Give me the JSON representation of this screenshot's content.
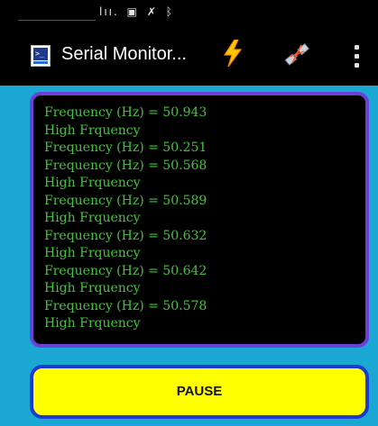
{
  "status_bar": {
    "signal_icon": "signal-bars-icon",
    "gallery_icon": "gallery-icon",
    "notification_icon": "muted-icon",
    "bluetooth_icon": "bluetooth-icon"
  },
  "app_bar": {
    "title": "Serial Monitor...",
    "app_icon": "serial-monitor-app-icon",
    "actions": [
      "lightning-bolt-icon",
      "connect-plug-icon",
      "overflow-menu-icon"
    ]
  },
  "monitor": {
    "lines": [
      "Frequency (Hz) = 50.943",
      "High Frquency",
      "Frequency (Hz) = 50.251",
      "Frequency (Hz) = 50.568",
      "High Frquency",
      "Frequency (Hz) = 50.589",
      "High Frquency",
      "Frequency (Hz) = 50.632",
      "High Frquency",
      "Frequency (Hz) = 50.642",
      "High Frquency",
      "Frequency (Hz) = 50.578",
      "High Frquency"
    ]
  },
  "controls": {
    "pause_label": "PAUSE"
  },
  "colors": {
    "background": "#1aa7d3",
    "monitor_border": "#6b3fd8",
    "monitor_text": "#43c43a",
    "button_fill": "#ffff00",
    "button_border": "#1d3ad0"
  }
}
